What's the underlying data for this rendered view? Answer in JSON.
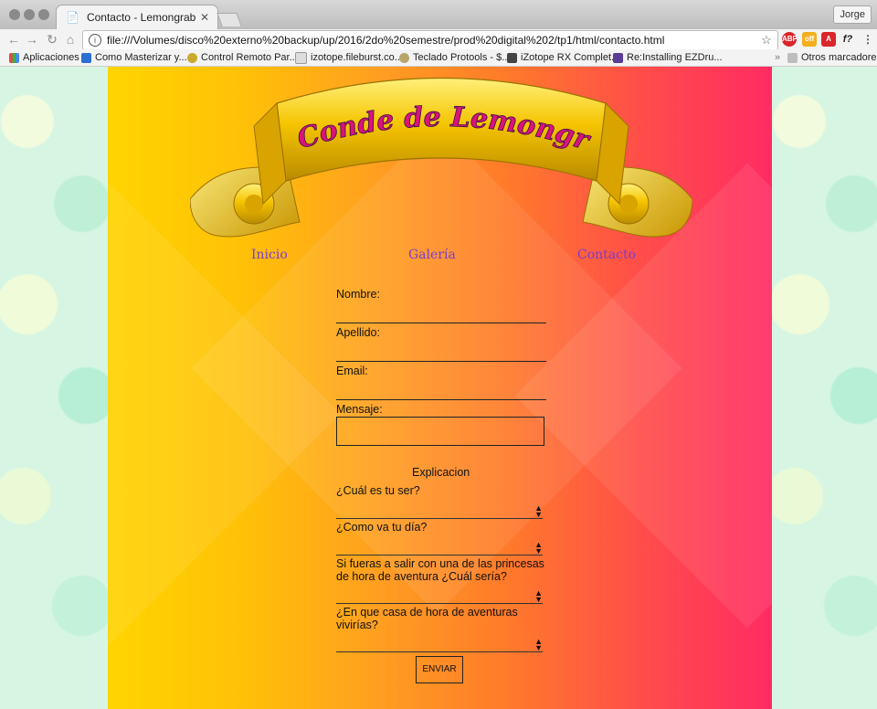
{
  "browser": {
    "tab_title": "Contacto - Lemongrab",
    "profile_name": "Jorge",
    "url": "file:///Volumes/disco%20externo%20backup/up/2016/2do%20semestre/prod%20digital%202/tp1/html/contacto.html",
    "bookmarks": [
      {
        "label": "Aplicaciones"
      },
      {
        "label": "Como Masterizar y..."
      },
      {
        "label": "Control Remoto Par..."
      },
      {
        "label": "izotope.fileburst.co..."
      },
      {
        "label": "Teclado Protools - $..."
      },
      {
        "label": "iZotope RX Complet..."
      },
      {
        "label": "Re:Installing EZDru..."
      }
    ],
    "other_bookmarks": "Otros marcadores",
    "extensions": [
      "ABP",
      "off",
      "acrobat",
      "f?"
    ]
  },
  "site": {
    "logo_text": "El Conde de Lemongrab",
    "nav": [
      {
        "label": "Inicio"
      },
      {
        "label": "Galería"
      },
      {
        "label": "Contacto"
      }
    ]
  },
  "form": {
    "nombre_label": "Nombre:",
    "apellido_label": "Apellido:",
    "email_label": "Email:",
    "mensaje_label": "Mensaje:",
    "section_title": "Explicacion",
    "q1": "¿Cuál es tu ser?",
    "q2": "¿Como va tu día?",
    "q3_line1": "Si fueras a salir con una de las princesas",
    "q3_line2": "de hora de aventura ¿Cuál sería?",
    "q4_line1": "¿En que casa de hora de aventuras",
    "q4_line2": "vivirías?",
    "submit_label": "ENVIAR"
  },
  "colors": {
    "nav_link": "#7a3ccf",
    "logo_text": "#d9147a",
    "banner_gold": "#f5c400"
  }
}
